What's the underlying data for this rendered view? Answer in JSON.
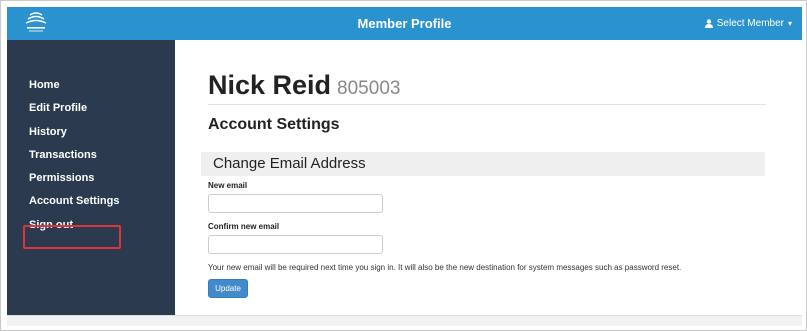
{
  "header": {
    "title": "Member Profile",
    "select_member_label": "Select Member",
    "background_color": "#2a92cf"
  },
  "sidebar": {
    "background_color": "#2b3a4f",
    "highlight_color": "#d9363e",
    "items": [
      {
        "label": "Home"
      },
      {
        "label": "Edit Profile"
      },
      {
        "label": "History"
      },
      {
        "label": "Transactions"
      },
      {
        "label": "Permissions"
      },
      {
        "label": "Account Settings",
        "active": true
      },
      {
        "label": "Sign out"
      }
    ]
  },
  "member": {
    "name": "Nick Reid",
    "id": "805003"
  },
  "page": {
    "section_title": "Account Settings",
    "panel_title": "Change Email Address",
    "new_email_label": "New email",
    "new_email_value": "",
    "confirm_email_label": "Confirm new email",
    "confirm_email_value": "",
    "help_text": "Your new email will be required next time you sign in. It will also be the new destination for system messages such as password reset.",
    "update_label": "Update",
    "update_color": "#428bca"
  },
  "icons": {
    "logo": "brand-logo-icon",
    "user": "user-icon",
    "caret": "caret-down-icon"
  }
}
